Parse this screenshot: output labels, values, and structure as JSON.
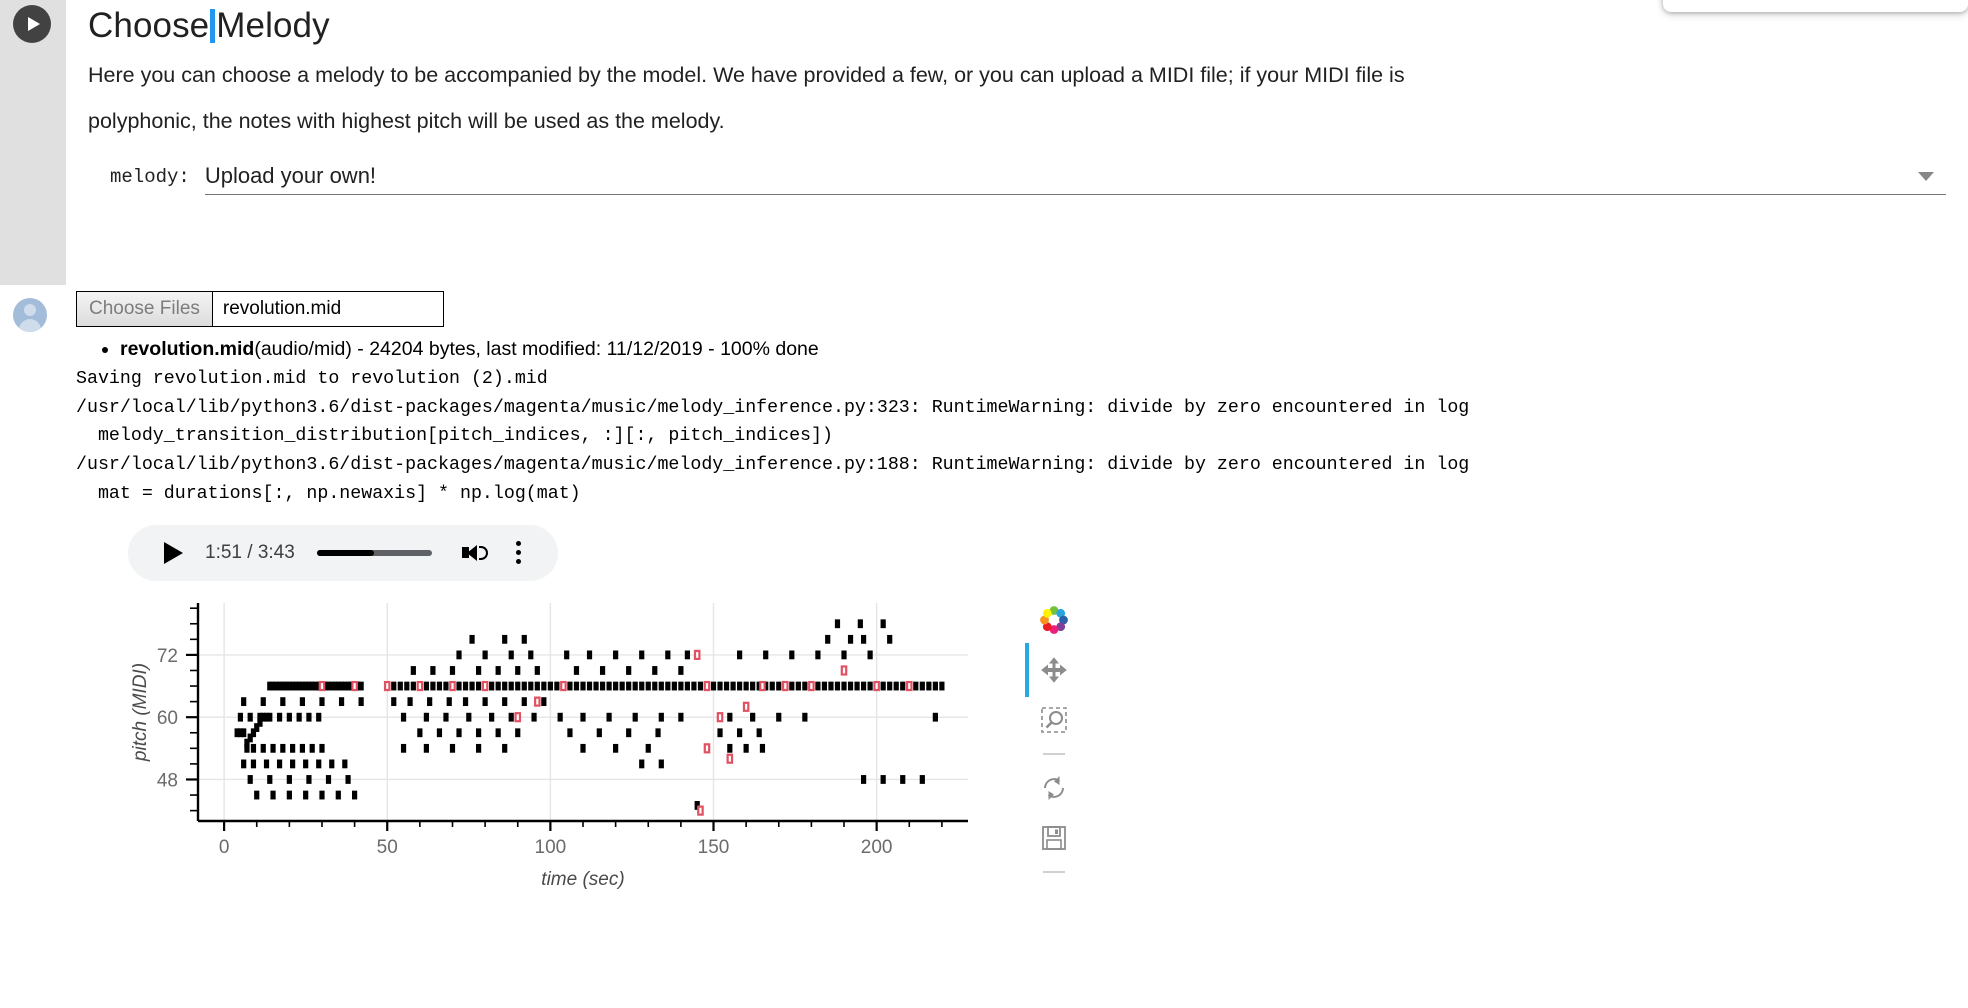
{
  "float_card": {
    "name": "floating-panel"
  },
  "cell": {
    "run_button": "run-cell",
    "title_before_caret": "Choose",
    "title_after_caret": "Melody",
    "paragraph_line1": "Here you can choose a melody to be accompanied by the model. We have provided a few, or you can upload a MIDI file; if your MIDI file is",
    "paragraph_line2": "polyphonic, the notes with highest pitch will be used as the melody."
  },
  "form": {
    "label": "melody:",
    "selected_value": "Upload your own!",
    "options": [
      "Upload your own!"
    ]
  },
  "output": {
    "choose_files_label": "Choose Files",
    "chosen_file": "revolution.mid",
    "file_info": {
      "name": "revolution.mid",
      "rest": "(audio/mid) - 24204 bytes, last modified: 11/12/2019 - 100% done"
    },
    "stream_lines": [
      "Saving revolution.mid to revolution (2).mid",
      "/usr/local/lib/python3.6/dist-packages/magenta/music/melody_inference.py:323: RuntimeWarning: divide by zero encountered in log",
      "  melody_transition_distribution[pitch_indices, :][:, pitch_indices])",
      "/usr/local/lib/python3.6/dist-packages/magenta/music/melody_inference.py:188: RuntimeWarning: divide by zero encountered in log",
      "  mat = durations[:, np.newaxis] * np.log(mat)"
    ]
  },
  "audio": {
    "current_time": "1:51",
    "duration": "3:43",
    "time_display": "1:51 / 3:43",
    "progress_percent": 50,
    "play_icon": "play-icon",
    "volume_icon": "volume-icon",
    "menu_icon": "more-vertical-icon"
  },
  "toolbar": {
    "items": [
      {
        "name": "bokeh-logo-icon",
        "label": "Bokeh"
      },
      {
        "name": "pan-tool-icon",
        "label": "Pan"
      },
      {
        "name": "box-zoom-tool-icon",
        "label": "Box Zoom"
      },
      {
        "name": "reset-tool-icon",
        "label": "Reset"
      },
      {
        "name": "save-tool-icon",
        "label": "Save"
      }
    ],
    "active_tool": "pan-tool-icon"
  },
  "chart_data": {
    "type": "scatter",
    "title": "",
    "xlabel": "time (sec)",
    "ylabel": "pitch (MIDI)",
    "xlim": [
      -8,
      228
    ],
    "ylim": [
      40,
      82
    ],
    "xticks": [
      0,
      50,
      100,
      150,
      200
    ],
    "yticks": [
      48,
      60,
      72
    ],
    "y_minor_step": 3,
    "x_minor_step": 10,
    "grid": true,
    "legend": null,
    "marker": "square",
    "colors": {
      "accompaniment": "#000000",
      "melody": "#e05262",
      "grid": "#e5e5e5",
      "axis": "#000000",
      "label": "#6b6b6b"
    },
    "series": [
      {
        "name": "accompaniment",
        "color": "#000000",
        "points": [
          [
            4,
            57
          ],
          [
            5,
            57
          ],
          [
            6,
            57
          ],
          [
            7,
            55
          ],
          [
            8,
            56
          ],
          [
            9,
            57
          ],
          [
            10,
            58
          ],
          [
            11,
            59
          ],
          [
            12,
            60
          ],
          [
            13,
            60
          ],
          [
            14,
            66
          ],
          [
            15,
            66
          ],
          [
            16,
            66
          ],
          [
            17,
            66
          ],
          [
            18,
            66
          ],
          [
            19,
            66
          ],
          [
            20,
            66
          ],
          [
            21,
            66
          ],
          [
            22,
            66
          ],
          [
            23,
            66
          ],
          [
            24,
            66
          ],
          [
            25,
            66
          ],
          [
            26,
            66
          ],
          [
            27,
            66
          ],
          [
            28,
            66
          ],
          [
            29,
            66
          ],
          [
            30,
            66
          ],
          [
            31,
            66
          ],
          [
            32,
            66
          ],
          [
            33,
            66
          ],
          [
            34,
            66
          ],
          [
            35,
            66
          ],
          [
            36,
            66
          ],
          [
            37,
            66
          ],
          [
            38,
            66
          ],
          [
            39,
            66
          ],
          [
            40,
            66
          ],
          [
            41,
            66
          ],
          [
            42,
            66
          ],
          [
            5,
            60
          ],
          [
            8,
            60
          ],
          [
            11,
            60
          ],
          [
            14,
            60
          ],
          [
            17,
            60
          ],
          [
            20,
            60
          ],
          [
            23,
            60
          ],
          [
            26,
            60
          ],
          [
            29,
            60
          ],
          [
            6,
            63
          ],
          [
            12,
            63
          ],
          [
            18,
            63
          ],
          [
            24,
            63
          ],
          [
            30,
            63
          ],
          [
            36,
            63
          ],
          [
            42,
            63
          ],
          [
            7,
            54
          ],
          [
            9,
            54
          ],
          [
            12,
            54
          ],
          [
            15,
            54
          ],
          [
            18,
            54
          ],
          [
            21,
            54
          ],
          [
            24,
            54
          ],
          [
            27,
            54
          ],
          [
            30,
            54
          ],
          [
            6,
            51
          ],
          [
            9,
            51
          ],
          [
            13,
            51
          ],
          [
            17,
            51
          ],
          [
            21,
            51
          ],
          [
            25,
            51
          ],
          [
            29,
            51
          ],
          [
            33,
            51
          ],
          [
            37,
            51
          ],
          [
            8,
            48
          ],
          [
            14,
            48
          ],
          [
            20,
            48
          ],
          [
            26,
            48
          ],
          [
            32,
            48
          ],
          [
            38,
            48
          ],
          [
            10,
            45
          ],
          [
            15,
            45
          ],
          [
            20,
            45
          ],
          [
            25,
            45
          ],
          [
            30,
            45
          ],
          [
            35,
            45
          ],
          [
            40,
            45
          ],
          [
            50,
            66
          ],
          [
            52,
            66
          ],
          [
            54,
            66
          ],
          [
            56,
            66
          ],
          [
            58,
            66
          ],
          [
            60,
            66
          ],
          [
            62,
            66
          ],
          [
            64,
            66
          ],
          [
            66,
            66
          ],
          [
            68,
            66
          ],
          [
            70,
            66
          ],
          [
            72,
            66
          ],
          [
            74,
            66
          ],
          [
            76,
            66
          ],
          [
            78,
            66
          ],
          [
            80,
            66
          ],
          [
            82,
            66
          ],
          [
            84,
            66
          ],
          [
            86,
            66
          ],
          [
            88,
            66
          ],
          [
            90,
            66
          ],
          [
            92,
            66
          ],
          [
            94,
            66
          ],
          [
            96,
            66
          ],
          [
            98,
            66
          ],
          [
            100,
            66
          ],
          [
            55,
            60
          ],
          [
            62,
            60
          ],
          [
            68,
            60
          ],
          [
            75,
            60
          ],
          [
            82,
            60
          ],
          [
            88,
            60
          ],
          [
            95,
            60
          ],
          [
            58,
            69
          ],
          [
            64,
            69
          ],
          [
            70,
            69
          ],
          [
            78,
            69
          ],
          [
            84,
            69
          ],
          [
            90,
            69
          ],
          [
            96,
            69
          ],
          [
            72,
            72
          ],
          [
            80,
            72
          ],
          [
            88,
            72
          ],
          [
            94,
            72
          ],
          [
            76,
            75
          ],
          [
            86,
            75
          ],
          [
            92,
            75
          ],
          [
            52,
            63
          ],
          [
            57,
            63
          ],
          [
            63,
            63
          ],
          [
            69,
            63
          ],
          [
            74,
            63
          ],
          [
            80,
            63
          ],
          [
            86,
            63
          ],
          [
            92,
            63
          ],
          [
            98,
            63
          ],
          [
            60,
            57
          ],
          [
            66,
            57
          ],
          [
            72,
            57
          ],
          [
            78,
            57
          ],
          [
            84,
            57
          ],
          [
            90,
            57
          ],
          [
            55,
            54
          ],
          [
            62,
            54
          ],
          [
            70,
            54
          ],
          [
            78,
            54
          ],
          [
            86,
            54
          ],
          [
            102,
            66
          ],
          [
            104,
            66
          ],
          [
            106,
            66
          ],
          [
            108,
            66
          ],
          [
            110,
            66
          ],
          [
            112,
            66
          ],
          [
            114,
            66
          ],
          [
            116,
            66
          ],
          [
            118,
            66
          ],
          [
            120,
            66
          ],
          [
            122,
            66
          ],
          [
            124,
            66
          ],
          [
            126,
            66
          ],
          [
            128,
            66
          ],
          [
            130,
            66
          ],
          [
            132,
            66
          ],
          [
            134,
            66
          ],
          [
            136,
            66
          ],
          [
            138,
            66
          ],
          [
            140,
            66
          ],
          [
            142,
            66
          ],
          [
            144,
            66
          ],
          [
            146,
            66
          ],
          [
            105,
            72
          ],
          [
            112,
            72
          ],
          [
            120,
            72
          ],
          [
            128,
            72
          ],
          [
            136,
            72
          ],
          [
            142,
            72
          ],
          [
            108,
            69
          ],
          [
            116,
            69
          ],
          [
            124,
            69
          ],
          [
            132,
            69
          ],
          [
            140,
            69
          ],
          [
            103,
            60
          ],
          [
            110,
            60
          ],
          [
            118,
            60
          ],
          [
            126,
            60
          ],
          [
            134,
            60
          ],
          [
            140,
            60
          ],
          [
            106,
            57
          ],
          [
            115,
            57
          ],
          [
            124,
            57
          ],
          [
            133,
            57
          ],
          [
            110,
            54
          ],
          [
            120,
            54
          ],
          [
            130,
            54
          ],
          [
            128,
            51
          ],
          [
            134,
            51
          ],
          [
            145,
            43
          ],
          [
            150,
            66
          ],
          [
            152,
            66
          ],
          [
            154,
            66
          ],
          [
            156,
            66
          ],
          [
            158,
            66
          ],
          [
            160,
            66
          ],
          [
            162,
            66
          ],
          [
            164,
            66
          ],
          [
            166,
            66
          ],
          [
            168,
            66
          ],
          [
            170,
            66
          ],
          [
            172,
            66
          ],
          [
            174,
            66
          ],
          [
            176,
            66
          ],
          [
            178,
            66
          ],
          [
            180,
            66
          ],
          [
            182,
            66
          ],
          [
            184,
            66
          ],
          [
            186,
            66
          ],
          [
            188,
            66
          ],
          [
            190,
            66
          ],
          [
            192,
            66
          ],
          [
            194,
            66
          ],
          [
            196,
            66
          ],
          [
            198,
            66
          ],
          [
            200,
            66
          ],
          [
            202,
            66
          ],
          [
            204,
            66
          ],
          [
            206,
            66
          ],
          [
            208,
            66
          ],
          [
            210,
            66
          ],
          [
            212,
            66
          ],
          [
            214,
            66
          ],
          [
            216,
            66
          ],
          [
            218,
            66
          ],
          [
            220,
            66
          ],
          [
            155,
            60
          ],
          [
            162,
            60
          ],
          [
            170,
            60
          ],
          [
            178,
            60
          ],
          [
            158,
            72
          ],
          [
            166,
            72
          ],
          [
            174,
            72
          ],
          [
            182,
            72
          ],
          [
            190,
            72
          ],
          [
            198,
            72
          ],
          [
            185,
            75
          ],
          [
            192,
            75
          ],
          [
            196,
            75
          ],
          [
            204,
            75
          ],
          [
            188,
            78
          ],
          [
            195,
            78
          ],
          [
            202,
            78
          ],
          [
            152,
            57
          ],
          [
            158,
            57
          ],
          [
            164,
            57
          ],
          [
            155,
            54
          ],
          [
            160,
            54
          ],
          [
            165,
            54
          ],
          [
            196,
            48
          ],
          [
            202,
            48
          ],
          [
            208,
            48
          ],
          [
            214,
            48
          ],
          [
            218,
            60
          ]
        ]
      },
      {
        "name": "melody",
        "color": "#e05262",
        "points": [
          [
            145,
            72
          ],
          [
            148,
            66
          ],
          [
            152,
            60
          ],
          [
            148,
            54
          ],
          [
            155,
            52
          ],
          [
            160,
            62
          ],
          [
            165,
            66
          ],
          [
            172,
            66
          ],
          [
            180,
            66
          ],
          [
            190,
            69
          ],
          [
            200,
            66
          ],
          [
            210,
            66
          ],
          [
            146,
            42
          ],
          [
            90,
            60
          ],
          [
            96,
            63
          ],
          [
            104,
            66
          ],
          [
            60,
            66
          ],
          [
            70,
            66
          ],
          [
            80,
            66
          ],
          [
            30,
            66
          ],
          [
            40,
            66
          ],
          [
            50,
            66
          ]
        ]
      }
    ]
  }
}
